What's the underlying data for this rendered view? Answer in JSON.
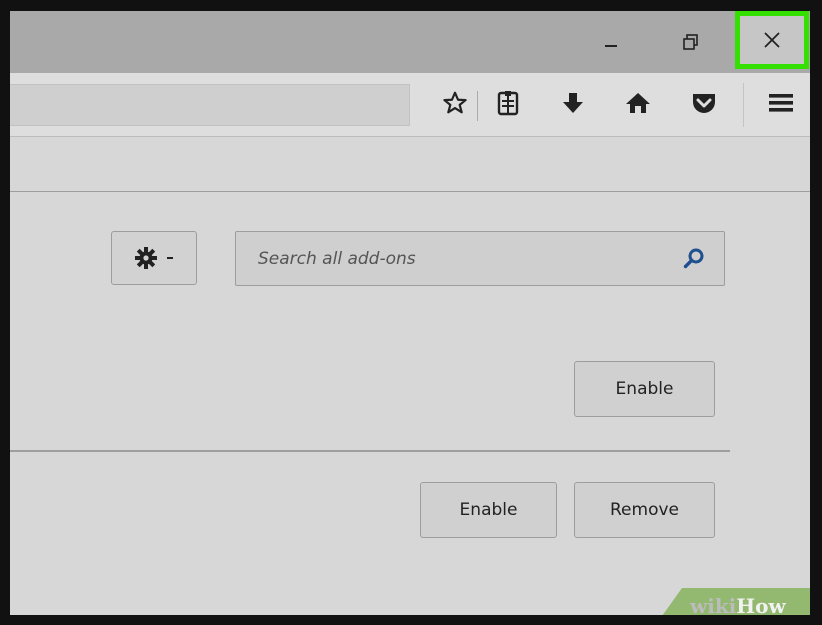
{
  "window_controls": {
    "minimize_icon": "minimize-icon",
    "restore_icon": "restore-icon",
    "close_icon": "close-icon",
    "close_highlight_color": "#33e000"
  },
  "toolbar": {
    "icons": [
      "star-bookmark-icon",
      "reading-list-icon",
      "download-arrow-icon",
      "home-icon",
      "pocket-icon",
      "hamburger-menu-icon"
    ]
  },
  "addons": {
    "tools_icon": "gear-icon",
    "search_placeholder": "Search all add-ons",
    "search_icon": "search-icon",
    "item1": {
      "enable_label": "Enable"
    },
    "item2": {
      "enable_label": "Enable",
      "remove_label": "Remove"
    }
  },
  "watermark": {
    "part1": "wiki",
    "part2": "How"
  }
}
